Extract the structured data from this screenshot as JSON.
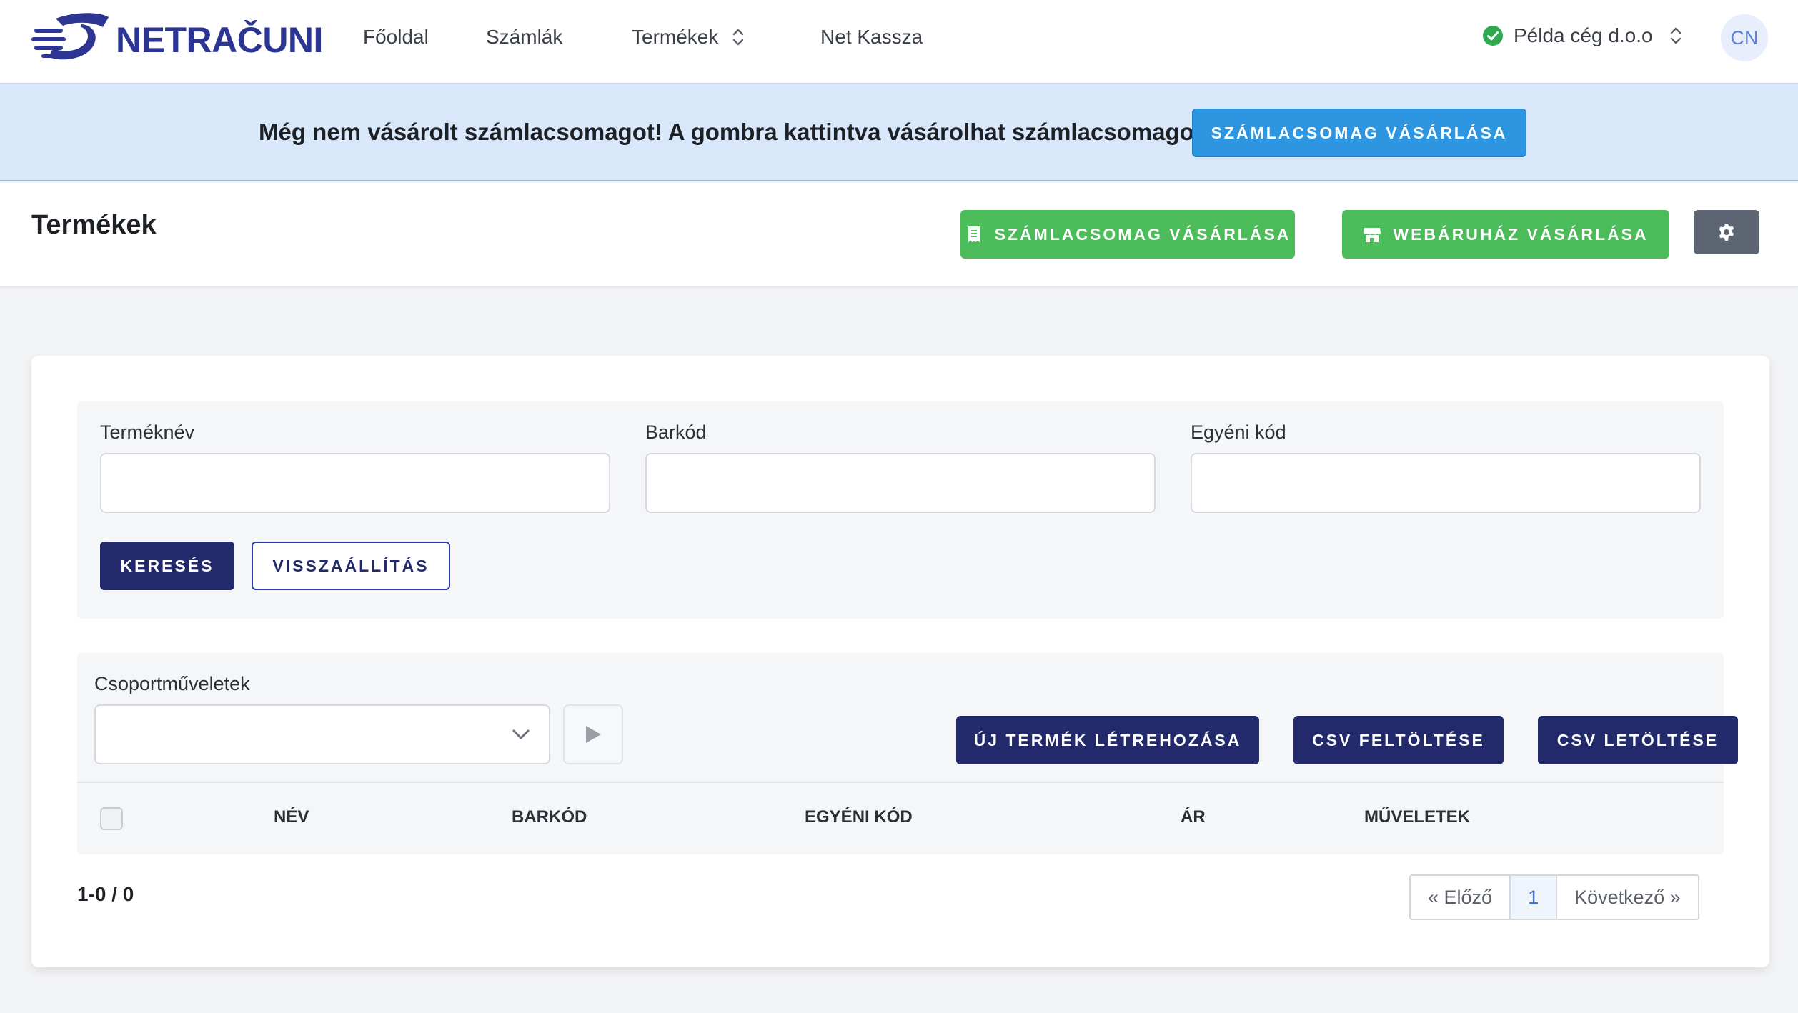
{
  "app": {
    "logo_text": "NETRAČUNI",
    "user_initials": "CN",
    "company": "Példa cég d.o.o"
  },
  "nav": {
    "items": [
      "Főoldal",
      "Számlák",
      "Termékek",
      "Net Kassza"
    ]
  },
  "banner": {
    "message": "Még nem vásárolt számlacsomagot! A gombra kattintva vásárolhat számlacsomagot.",
    "button_label": "SZÁMLACSOMAG VÁSÁRLÁSA"
  },
  "header": {
    "title": "Termékek",
    "buy_package_label": "SZÁMLACSOMAG VÁSÁRLÁSA",
    "buy_webshop_label": "WEBÁRUHÁZ VÁSÁRLÁSA"
  },
  "filters": {
    "name_label": "Terméknév",
    "name_value": "",
    "barcode_label": "Barkód",
    "barcode_value": "",
    "code_label": "Egyéni kód",
    "code_value": "",
    "search_label": "KERESÉS",
    "reset_label": "VISSZAÁLLÍTÁS"
  },
  "bulk": {
    "label": "Csoportműveletek",
    "selected": "",
    "new_product_label": "ÚJ TERMÉK LÉTREHOZÁSA",
    "csv_upload_label": "CSV FELTÖLTÉSE",
    "csv_download_label": "CSV LETÖLTÉSE"
  },
  "table": {
    "columns": [
      "NÉV",
      "BARKÓD",
      "EGYÉNI KÓD",
      "ÁR",
      "MŰVELETEK"
    ]
  },
  "pagination": {
    "summary": "1-0 / 0",
    "prev": "« Előző",
    "current": "1",
    "next": "Következő »"
  },
  "colors": {
    "brand": "#2c3591",
    "banner_bg": "#d9e7fa",
    "primary_blue": "#2e95e0",
    "success_green": "#4cbb5a",
    "navy": "#232a6b"
  }
}
